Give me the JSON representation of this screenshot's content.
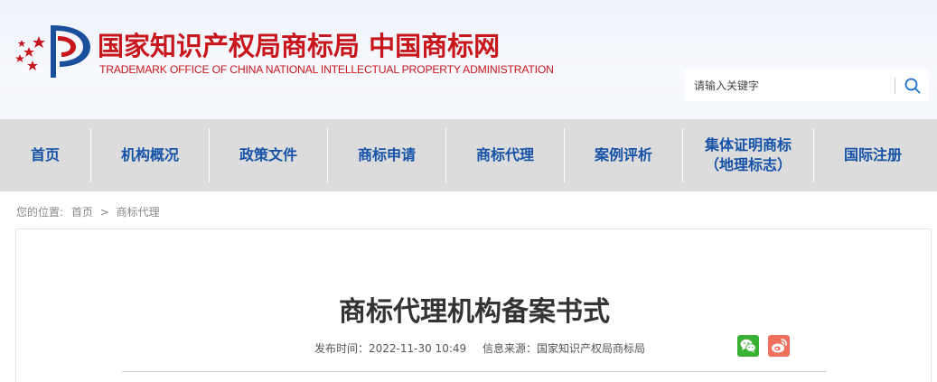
{
  "header": {
    "title_cn": "国家知识产权局商标局 中国商标网",
    "title_en": "TRADEMARK OFFICE OF CHINA NATIONAL INTELLECTUAL PROPERTY ADMINISTRATION",
    "search_placeholder": "请输入关键字"
  },
  "nav": {
    "items": [
      {
        "label": "首页"
      },
      {
        "label": "机构概况"
      },
      {
        "label": "政策文件"
      },
      {
        "label": "商标申请"
      },
      {
        "label": "商标代理"
      },
      {
        "label": "案例评析"
      },
      {
        "label_line1": "集体证明商标",
        "label_line2": "（地理标志）"
      },
      {
        "label": "国际注册"
      }
    ]
  },
  "breadcrumb": {
    "prefix": "您的位置:",
    "home": "首页",
    "separator": ">",
    "current": "商标代理"
  },
  "article": {
    "title": "商标代理机构备案书式",
    "publish_time": "发布时间：2022-11-30 10:49",
    "source": "信息来源：国家知识产权局商标局"
  },
  "colors": {
    "brand_red": "#c8161d",
    "nav_blue": "#1652a8",
    "nav_bg": "#dcdcdc"
  }
}
